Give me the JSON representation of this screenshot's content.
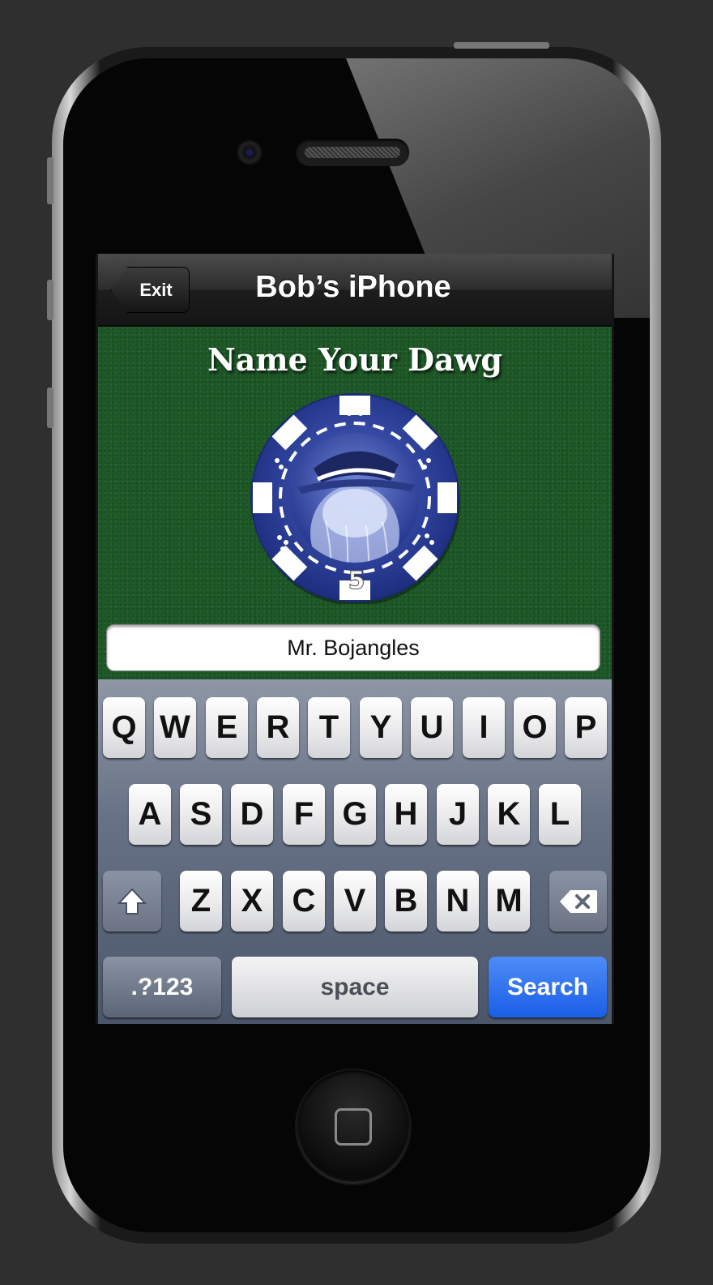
{
  "navbar": {
    "back_label": "Exit",
    "title": "Bob’s iPhone"
  },
  "screen": {
    "headline": "Name Your Dawg",
    "chip_value": "5",
    "name_input_value": "Mr. Bojangles"
  },
  "keyboard": {
    "row1": [
      "Q",
      "W",
      "E",
      "R",
      "T",
      "Y",
      "U",
      "I",
      "O",
      "P"
    ],
    "row2": [
      "A",
      "S",
      "D",
      "F",
      "G",
      "H",
      "J",
      "K",
      "L"
    ],
    "row3": [
      "Z",
      "X",
      "C",
      "V",
      "B",
      "N",
      "M"
    ],
    "numbers_label": ".?123",
    "space_label": "space",
    "action_label": "Search",
    "shift_icon": "shift-arrow-icon",
    "delete_icon": "backspace-icon"
  },
  "colors": {
    "felt_green": "#1e5a28",
    "chip_blue": "#2a3f9a",
    "search_blue": "#1a5ee6"
  }
}
